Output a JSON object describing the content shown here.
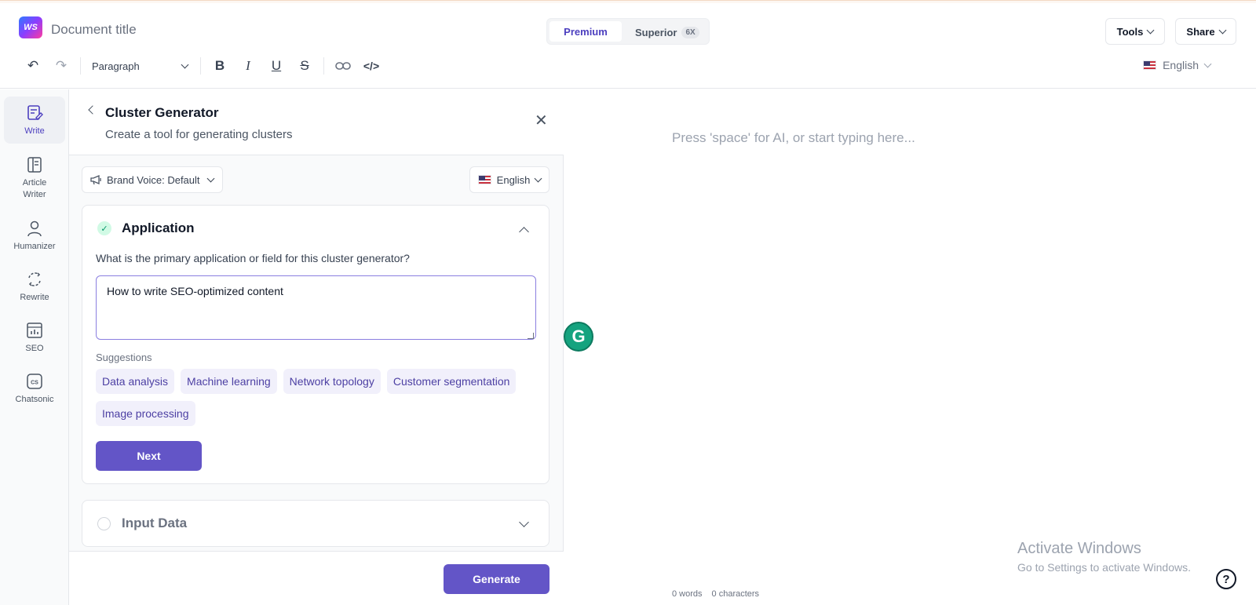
{
  "header": {
    "logo_text": "WS",
    "document_title": "Document title",
    "plans": {
      "premium": "Premium",
      "superior": "Superior",
      "superior_badge": "6X"
    },
    "tools_label": "Tools",
    "share_label": "Share",
    "language": "English"
  },
  "toolbar": {
    "paragraph_label": "Paragraph",
    "icons": [
      "undo-icon",
      "redo-icon",
      "bold-icon",
      "italic-icon",
      "underline-icon",
      "strikethrough-icon",
      "link-icon",
      "code-icon"
    ]
  },
  "sidebar": {
    "items": [
      {
        "label": "Write",
        "icon": "write-icon",
        "active": true
      },
      {
        "label": "Article Writer",
        "icon": "article-icon",
        "active": false
      },
      {
        "label": "Humanizer",
        "icon": "person-icon",
        "active": false
      },
      {
        "label": "Rewrite",
        "icon": "rewrite-icon",
        "active": false
      },
      {
        "label": "SEO",
        "icon": "seo-chart-icon",
        "active": false
      },
      {
        "label": "Chatsonic",
        "icon": "chatsonic-icon",
        "active": false
      }
    ]
  },
  "panel": {
    "title": "Cluster Generator",
    "subtitle": "Create a tool for generating clusters",
    "brand_voice": "Brand Voice: Default",
    "language": "English",
    "application": {
      "title": "Application",
      "question": "What is the primary application or field for this cluster generator?",
      "answer": "How to write SEO-optimized content",
      "suggestions_label": "Suggestions",
      "suggestions": [
        "Data analysis",
        "Machine learning",
        "Network topology",
        "Customer segmentation",
        "Image processing"
      ],
      "next_label": "Next"
    },
    "input_data": {
      "title": "Input Data"
    },
    "generate_label": "Generate"
  },
  "editor": {
    "placeholder": "Press 'space' for AI, or start typing here...",
    "word_count": "0 words",
    "char_count": "0 characters"
  },
  "overlay": {
    "windows_line1": "Activate Windows",
    "windows_line2": "Go to Settings to activate Windows.",
    "help_symbol": "?"
  }
}
